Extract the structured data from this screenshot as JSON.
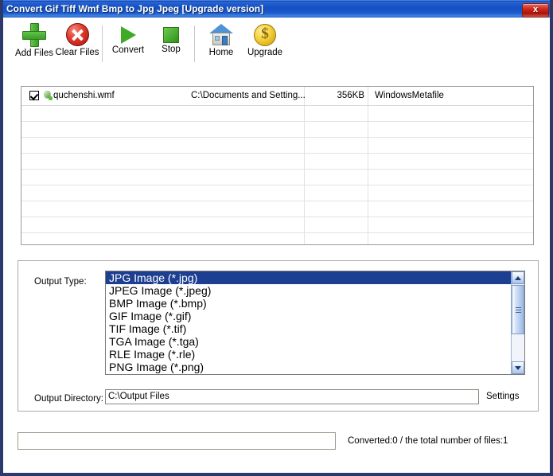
{
  "window": {
    "title": "Convert Gif Tiff Wmf Bmp to Jpg Jpeg [Upgrade version]",
    "close_label": "x",
    "accent_titlebar": "#1550c3",
    "accent_selection": "#1d3f91",
    "border_color": "#2b3a6b"
  },
  "toolbar": {
    "buttons": [
      {
        "label": "Add Files",
        "icon": "plus-icon"
      },
      {
        "label": "Clear Files",
        "icon": "x-circle-icon"
      },
      {
        "label": "Convert",
        "icon": "play-icon"
      },
      {
        "label": "Stop",
        "icon": "stop-square-icon"
      },
      {
        "label": "Home",
        "icon": "house-icon"
      },
      {
        "label": "Upgrade",
        "icon": "dollar-coin-icon"
      }
    ]
  },
  "file_list": {
    "rows": [
      {
        "checked": true,
        "icon": "wmf-file-icon",
        "name": "quchenshi.wmf",
        "path": "C:\\Documents and Setting...",
        "size": "356KB",
        "type": "WindowsMetafile"
      }
    ],
    "empty_row_count": 9
  },
  "output": {
    "type_label": "Output Type:",
    "type_options": [
      "JPG Image (*.jpg)",
      "JPEG Image (*.jpeg)",
      "BMP Image (*.bmp)",
      "GIF Image (*.gif)",
      "TIF Image (*.tif)",
      "TGA Image (*.tga)",
      "RLE Image (*.rle)",
      "PNG Image (*.png)"
    ],
    "type_selected_index": 0,
    "directory_label": "Output Directory:",
    "directory_value": "C:\\Output Files",
    "settings_label": "Settings"
  },
  "status": {
    "text": "Converted:0  /  the total number of files:1",
    "progress_percent": 0
  }
}
